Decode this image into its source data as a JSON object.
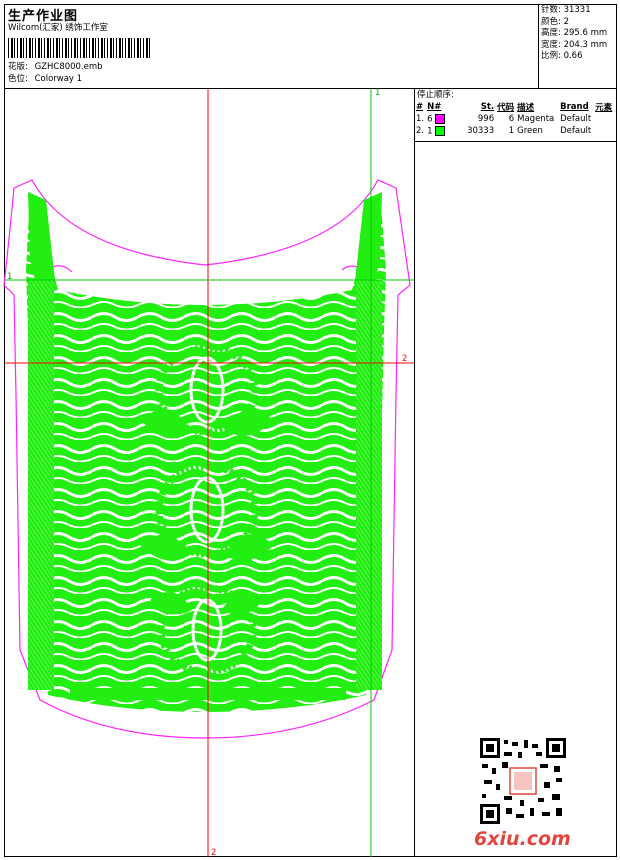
{
  "header": {
    "title": "生产作业图",
    "software": "Wilcom(汇家) 绣饰工作室",
    "design_label": "花版:",
    "design_file": "GZHC8000.emb",
    "colorway_label": "色位:",
    "colorway": "Colorway 1"
  },
  "stats": {
    "stitches": "针数: 31331",
    "colors": "颜色: 2",
    "height": "高度: 295.6 mm",
    "width": "宽度: 204.3 mm",
    "scale": "比例: 0.66"
  },
  "stop_sequence": {
    "title": "停止顺序:",
    "headers": [
      "#",
      "N#",
      "St.",
      "代码",
      "描述",
      "Brand",
      "元素"
    ],
    "rows": [
      {
        "index": "1.",
        "n": "6",
        "color": "#ff00ff",
        "stitches": "996",
        "code": "6",
        "desc": "Magenta",
        "brand": "Default"
      },
      {
        "index": "2.",
        "n": "1",
        "color": "#00ff00",
        "stitches": "30333",
        "code": "1",
        "desc": "Green",
        "brand": "Default"
      }
    ]
  },
  "canvas": {
    "marker_top_green": "1",
    "marker_left_green": "1",
    "marker_right_red": "2",
    "marker_bottom_red": "2",
    "stitch_color": "#22ee11",
    "outline_color": "#ff22ff",
    "guide_red": "#ff0000",
    "guide_green": "#00cc00"
  },
  "watermark": {
    "text": "6xiu.com"
  }
}
